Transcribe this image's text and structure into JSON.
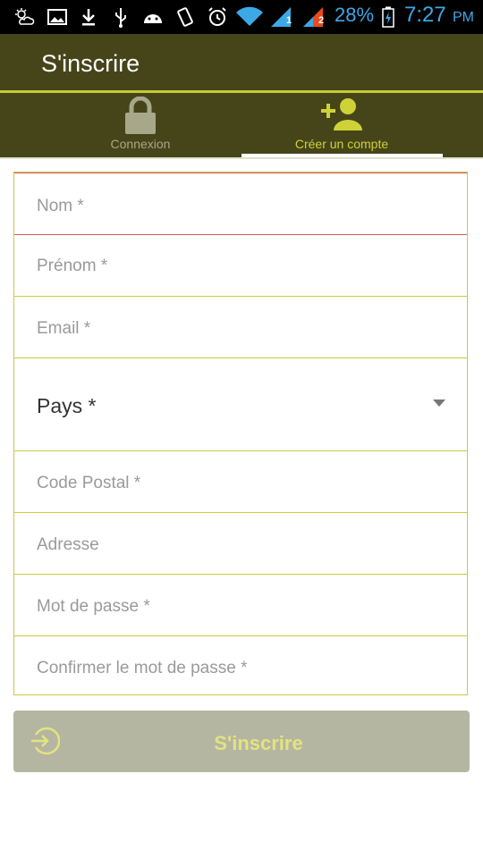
{
  "status_bar": {
    "battery": "28%",
    "time": "7:27",
    "ampm": "PM",
    "signal_1": "1",
    "signal_2": "2",
    "icons": [
      "weather-icon",
      "image-icon",
      "download-icon",
      "usb-icon",
      "android-icon",
      "vibrate-icon",
      "alarm-icon",
      "wifi-icon",
      "signal-icon",
      "signal-icon",
      "battery-charging-icon"
    ],
    "time_color": "#3da8e6"
  },
  "app_bar": {
    "title": "S'inscrire",
    "background": "#46451a",
    "accent": "#c6c93a"
  },
  "tabs": [
    {
      "label": "Connexion",
      "icon": "lock-icon",
      "selected": false
    },
    {
      "label": "Créer un compte",
      "icon": "add-person-icon",
      "selected": true
    }
  ],
  "form": {
    "fields": [
      {
        "label": "Nom *",
        "error": true
      },
      {
        "label": "Prénom *"
      },
      {
        "label": "Email *"
      },
      {
        "label": "Pays *",
        "type": "select"
      },
      {
        "label": "Code Postal *"
      },
      {
        "label": "Adresse"
      },
      {
        "label": "Mot de passe *"
      },
      {
        "label": "Confirmer le mot de passe *"
      }
    ]
  },
  "submit_button": {
    "label": "S'inscrire",
    "icon": "sign-in-icon",
    "enabled": false
  }
}
